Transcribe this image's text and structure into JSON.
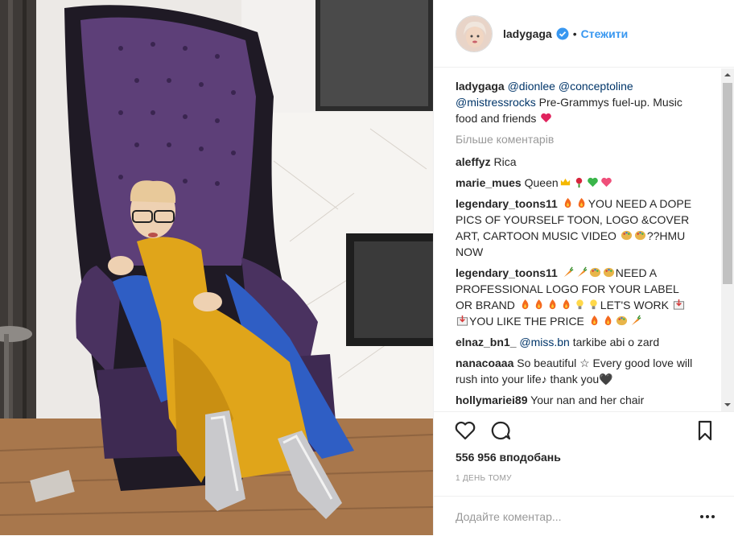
{
  "post": {
    "username": "ladygaga",
    "follow_label": "Стежити",
    "dot": "•"
  },
  "caption": {
    "username": "ladygaga",
    "mentions": [
      "@dionlee",
      "@conceptoline",
      "@mistressrocks"
    ],
    "text": "Pre-Grammys fuel-up. Music food and friends",
    "emoji": "red-heart"
  },
  "more_comments_label": "Більше коментарів",
  "comments": [
    {
      "user": "aleffyz",
      "text": "Rica"
    },
    {
      "user": "marie_mues",
      "text": "Queen",
      "emojis": [
        "crown",
        "rose",
        "green-heart",
        "pink-heart"
      ]
    },
    {
      "user": "legendary_toons11",
      "pre_emojis": [
        "fire",
        "fire"
      ],
      "text": "YOU NEED A DOPE PICS OF YOURSELF TOON, LOGO &COVER ART, CARTOON MUSIC VIDEO",
      "post_emojis": [
        "palette",
        "palette"
      ],
      "tail": "??HMU NOW"
    },
    {
      "user": "legendary_toons11",
      "pre_emojis": [
        "carrot",
        "carrot",
        "palette",
        "palette"
      ],
      "text": "NEED A PROFESSIONAL LOGO FOR YOUR LABEL OR BRAND",
      "post_emojis": [
        "fire",
        "fire",
        "fire",
        "fire",
        "bulb",
        "bulb"
      ],
      "tail": "LET'S WORK",
      "tail_emojis": [
        "inbox",
        "inbox"
      ],
      "tail2": "YOU LIKE THE PRICE",
      "tail2_emojis": [
        "fire",
        "fire",
        "palette",
        "carrot"
      ]
    },
    {
      "user": "elnaz_bn1_",
      "mention": "@miss.bn",
      "text": "tarkibe abi o zard"
    },
    {
      "user": "nanacoaaa",
      "text": "So beautiful ☆   Every good love will rush into your life♪   thank you🖤"
    },
    {
      "user": "hollymariei89",
      "text": "Your nan and her chair"
    }
  ],
  "likes_label": "556 956 вподобань",
  "time_label": "1 ДЕНЬ ТОМУ",
  "add_comment_placeholder": "Додайте коментар...",
  "colors": {
    "accent": "#3897f0",
    "mention": "#003569",
    "muted": "#999999",
    "border": "#efefef",
    "chair_purple": "#5d3f78",
    "dress_yellow": "#e0a51a",
    "coat_blue": "#2f5ec4"
  },
  "icons": [
    "heart-icon",
    "comment-icon",
    "bookmark-icon",
    "more-icon",
    "verified-badge-icon"
  ]
}
